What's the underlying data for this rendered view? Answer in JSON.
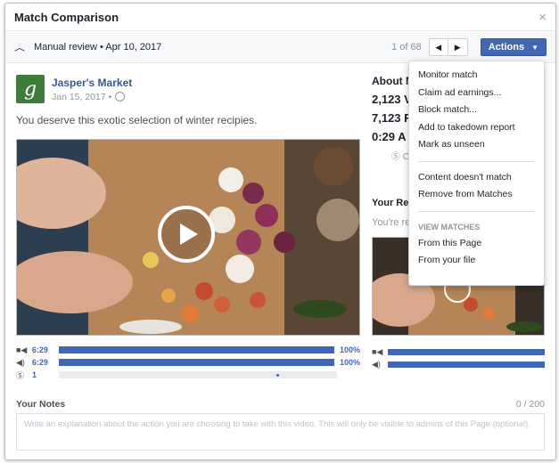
{
  "dialog": {
    "title": "Match Comparison",
    "close_glyph": "×"
  },
  "subbar": {
    "review_label": "Manual review • Apr 10, 2017",
    "pager": "1 of 68",
    "prev_glyph": "◀",
    "next_glyph": "▶",
    "actions_label": "Actions",
    "actions_caret": "▼"
  },
  "post": {
    "page_name": "Jasper's Market",
    "date": "Jan 15, 2017 •",
    "text": "You deserve this exotic selection of winter recipies.",
    "logo_letter": "g"
  },
  "metrics": {
    "rows": [
      {
        "icon": "video-icon",
        "glyph": "■◀",
        "value": "6:29",
        "fill": 1.0,
        "pct": "100%"
      },
      {
        "icon": "audio-icon",
        "glyph": "◀)",
        "value": "6:29",
        "fill": 1.0,
        "pct": "100%"
      },
      {
        "icon": "dollar-icon",
        "glyph": "Ⓢ",
        "value": "1",
        "fill": 0.0,
        "pct": ""
      }
    ]
  },
  "about": {
    "heading": "About M",
    "stats": [
      "2,123 V",
      "7,123 R",
      "0:29 A"
    ],
    "stat4": "Ⓢ C"
  },
  "reference": {
    "heading": "Your Ref",
    "sub": "You're re"
  },
  "notes": {
    "heading": "Your Notes",
    "count": "0 / 200",
    "placeholder": "Write an explanation about the action you are choosing to take with this video. This will only be visible to admins of this Page (optional)."
  },
  "menu": {
    "group1": [
      "Monitor match",
      "Claim ad earnings...",
      "Block match...",
      "Add to takedown report",
      "Mark as unseen"
    ],
    "group2": [
      "Content doesn't match",
      "Remove from Matches"
    ],
    "view_heading": "VIEW MATCHES",
    "group3": [
      "From this Page",
      "From your file"
    ]
  }
}
